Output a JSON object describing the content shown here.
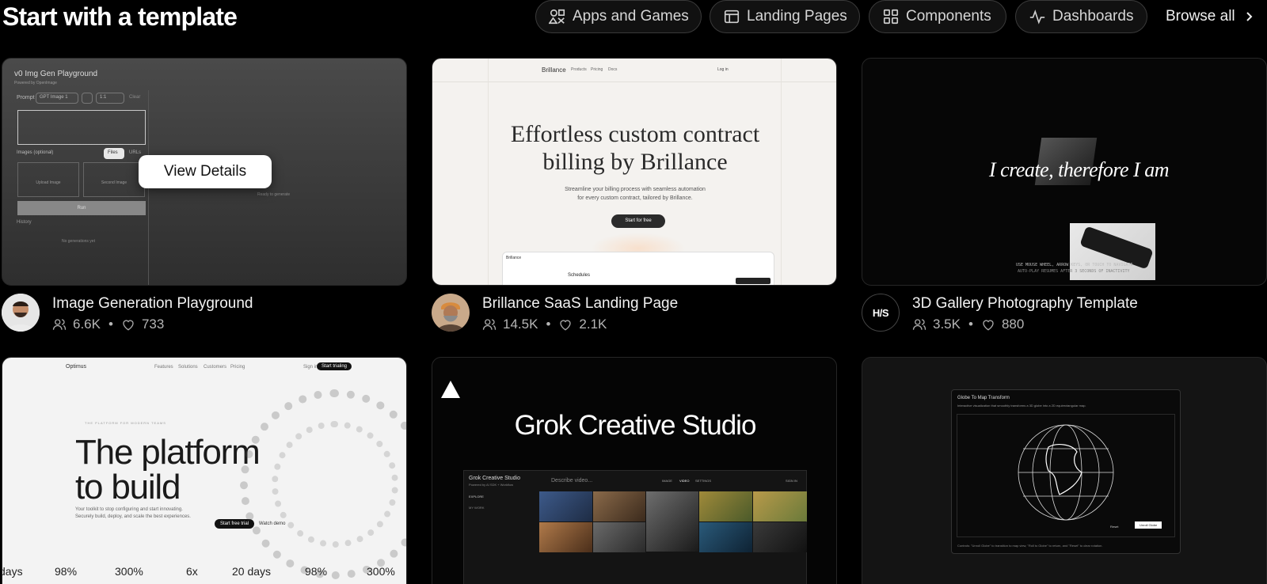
{
  "header": {
    "title": "Start with a template",
    "filters": [
      {
        "label": "Apps and Games",
        "icon": "shapes-icon"
      },
      {
        "label": "Landing Pages",
        "icon": "layout-icon"
      },
      {
        "label": "Components",
        "icon": "grid-icon"
      },
      {
        "label": "Dashboards",
        "icon": "activity-icon"
      }
    ],
    "browse_all": "Browse all"
  },
  "overlay": {
    "view_details": "View Details"
  },
  "templates": [
    {
      "title": "Image Generation Playground",
      "views": "6.6K",
      "likes": "733",
      "preview": {
        "app_title": "Img Gen Playground",
        "brand_mark": "v0",
        "powered_by": "Powered by OpenImage",
        "prompt_label": "Prompt",
        "model": "GPT Image 1",
        "ratio": "1:1",
        "clear": "Clear",
        "images_label": "Images (optional)",
        "tab_files": "Files",
        "tab_urls": "URLs",
        "upload_1": "Upload Image",
        "upload_2": "Second Image",
        "run": "Run",
        "history": "History",
        "empty": "No generations yet",
        "ready": "Ready to generate"
      }
    },
    {
      "title": "Brillance SaaS Landing Page",
      "views": "14.5K",
      "likes": "2.1K",
      "preview": {
        "logo": "Brillance",
        "nav": [
          "Products",
          "Pricing",
          "Docs"
        ],
        "login": "Log in",
        "headline_1": "Effortless custom contract",
        "headline_2": "billing by Brillance",
        "sub_1": "Streamline your billing process with seamless automation",
        "sub_2": "for every custom contract, tailored by Brillance.",
        "cta": "Start for free",
        "dash_logo": "Brillance",
        "dash_heading": "Schedules"
      }
    },
    {
      "title": "3D Gallery Photography Template",
      "views": "3.5K",
      "likes": "880",
      "avatar_text": "H/S",
      "preview": {
        "quote": "I create, therefore I am",
        "hint": "USE MOUSE WHEEL, ARROW KEYS, OR TOUCH TO NAVIGATE",
        "hint_2": "AUTO-PLAY RESUMES AFTER 3 SECONDS OF INACTIVITY"
      }
    },
    {
      "title": "",
      "views": "",
      "likes": "",
      "preview": {
        "logo": "Optimus",
        "nav": [
          "Features",
          "Solutions",
          "Customers",
          "Pricing"
        ],
        "sign_in": "Sign in",
        "start": "Start trialing",
        "eyebrow": "THE PLATFORM FOR MODERN TEAMS",
        "headline_1": "The platform",
        "headline_2": "to build",
        "body": "Your toolkit to stop configuring and start innovating. Securely build, deploy, and scale the best experiences.",
        "btn_primary": "Start free trial",
        "btn_secondary": "Watch demo",
        "metrics": [
          "days",
          "98%",
          "300%",
          "6x",
          "20 days",
          "98%",
          "300%"
        ]
      }
    },
    {
      "title": "",
      "views": "",
      "likes": "",
      "preview": {
        "brand": "Grok Creative Studio",
        "app_name": "Grok Creative Studio",
        "powered": "Powered by AI SDK + Workflow",
        "search": "Describe video...",
        "tabs": [
          "IMAGE",
          "VIDEO",
          "SETTINGS"
        ],
        "sign_in": "SIGN IN",
        "menu": [
          "EXPLORE",
          "MY WORK"
        ]
      }
    },
    {
      "title": "",
      "views": "",
      "likes": "",
      "preview": {
        "win_title": "Globe To Map Transform",
        "win_sub": "Interactive visualization that smoothly transforms a 3D globe into a 2D equirectangular map.",
        "reset": "Reset",
        "unroll": "Unroll Globe",
        "footer": "Controls: \"Unroll Globe\" to transition to map view, \"Roll to Globe\" to return, and \"Reset\" to clear rotation."
      }
    }
  ],
  "colors": {
    "background": "#000000",
    "chip_border": "#3a3a3a",
    "chip_bg": "#111111",
    "overlay_button": "#ffffff"
  }
}
